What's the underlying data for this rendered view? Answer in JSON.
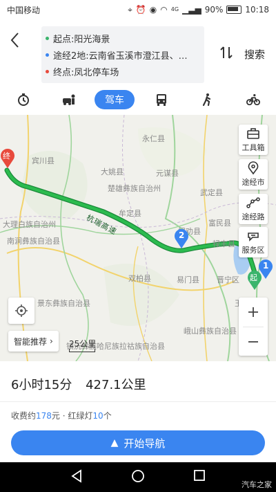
{
  "status_bar": {
    "carrier": "中国移动",
    "battery": "90%",
    "time": "10:18",
    "network": "4G"
  },
  "route": {
    "start": "起点:阳光海景",
    "via": "途经2地:云南省玉溪市澄江县、…",
    "end": "终点:凤北停车场",
    "search_label": "搜索",
    "colors": {
      "start": "#3bb46c",
      "via": "#3a85f0",
      "end": "#e84a3c"
    }
  },
  "tabs": [
    {
      "name": "taxi",
      "icon": "stopwatch-icon"
    },
    {
      "name": "designated-driver",
      "icon": "car-person-icon"
    },
    {
      "name": "drive",
      "label": "驾车",
      "active": true
    },
    {
      "name": "bus",
      "icon": "bus-icon"
    },
    {
      "name": "walk",
      "icon": "walk-icon"
    },
    {
      "name": "bike",
      "icon": "bike-icon"
    }
  ],
  "map": {
    "places": [
      "永仁县",
      "宾川县",
      "大姚县",
      "元谋县",
      "楚雄彝族自治州",
      "武定县",
      "牟定县",
      "禄劝县",
      "富民县",
      "禄丰县",
      "大理白族自治州",
      "南涧彝族自治县",
      "双柏县",
      "易门县",
      "晋宁区",
      "景东彝族自治县",
      "峨山彝族自治县",
      "玉溪",
      "镇沅彝族哈尼族拉祜族自治县"
    ],
    "road_label": "杭瑞高速",
    "end_marker": "终",
    "start_marker": "起",
    "via_markers": [
      "1",
      "2"
    ],
    "side_buttons": {
      "toolbox": "工具箱",
      "via_city": "途经市",
      "via_road": "途经路",
      "service": "服务区"
    },
    "smart_recommend": "智能推荐",
    "scale": "25公里"
  },
  "summary": {
    "duration": "6小时15分",
    "distance": "427.1公里"
  },
  "fees": {
    "toll_prefix": "收费约",
    "toll_value": "178",
    "toll_unit": "元",
    "sep": " · ",
    "light_prefix": "红绿灯",
    "light_value": "10",
    "light_unit": "个"
  },
  "start_nav": "开始导航",
  "watermark": "汽车之家"
}
